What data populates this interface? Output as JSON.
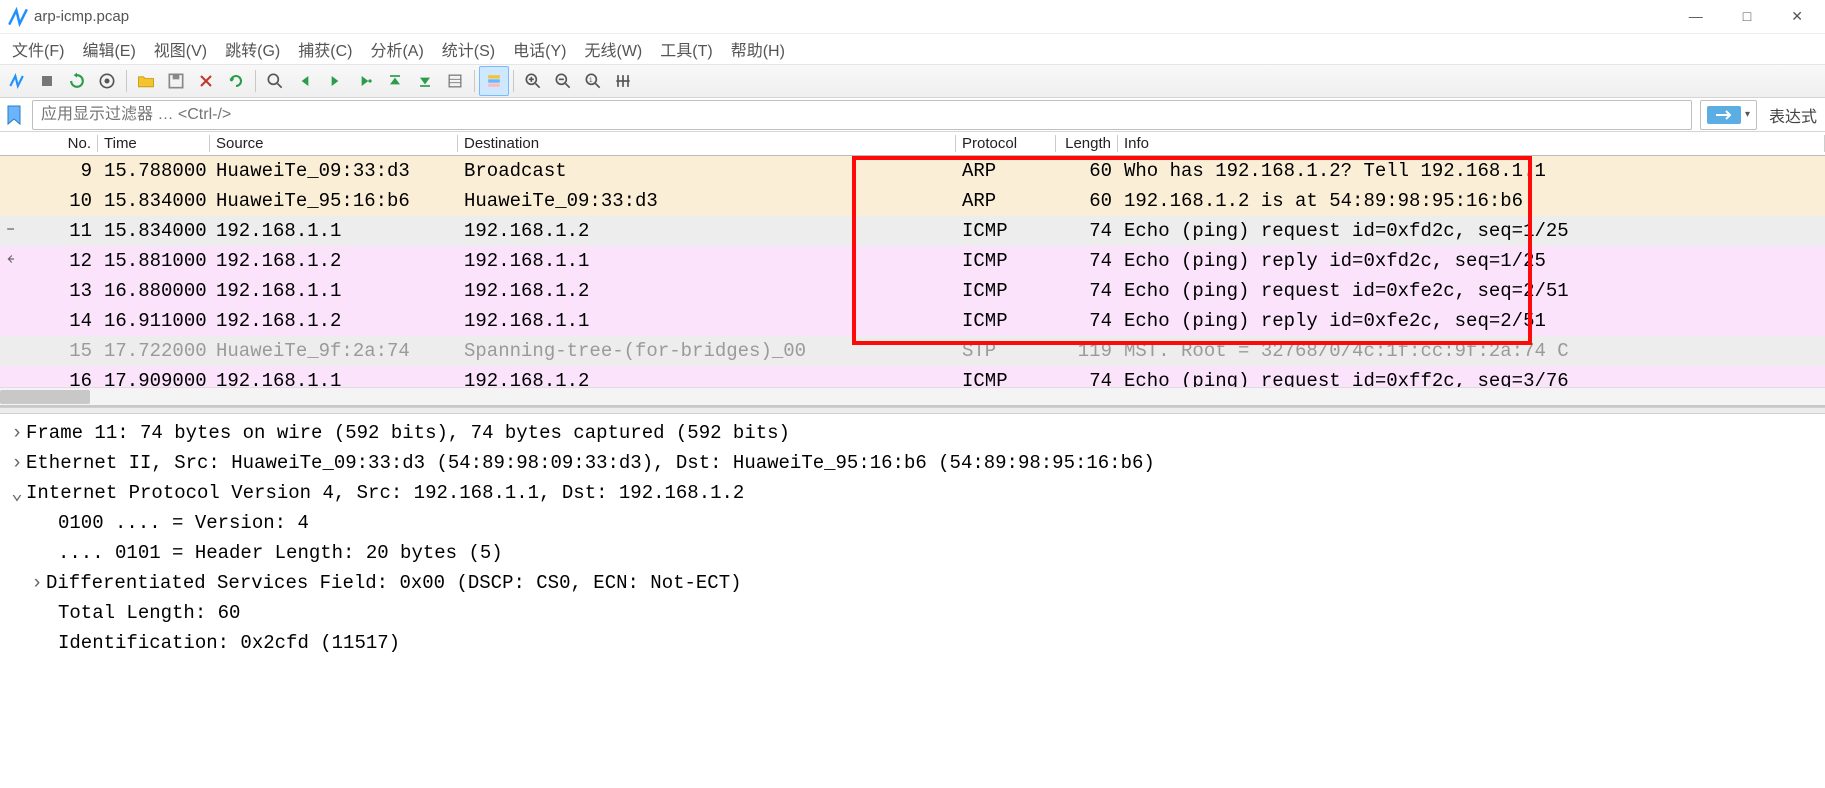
{
  "window": {
    "title": "arp-icmp.pcap",
    "buttons": {
      "min": "—",
      "max": "□",
      "close": "✕"
    }
  },
  "menu": {
    "file": "文件(F)",
    "edit": "编辑(E)",
    "view": "视图(V)",
    "go": "跳转(G)",
    "capture": "捕获(C)",
    "analyze": "分析(A)",
    "stats": "统计(S)",
    "teleph": "电话(Y)",
    "wireless": "无线(W)",
    "tools": "工具(T)",
    "help": "帮助(H)"
  },
  "filter": {
    "placeholder": "应用显示过滤器 … <Ctrl-/>",
    "expression": "表达式"
  },
  "columns": {
    "no": "No.",
    "time": "Time",
    "source": "Source",
    "destination": "Destination",
    "protocol": "Protocol",
    "length": "Length",
    "info": "Info"
  },
  "packets": [
    {
      "no": "9",
      "time": "15.788000",
      "src": "HuaweiTe_09:33:d3",
      "dst": "Broadcast",
      "proto": "ARP",
      "len": "60",
      "info": "Who has 192.168.1.2? Tell 192.168.1.1",
      "cls": "bg-arp",
      "arrow": ""
    },
    {
      "no": "10",
      "time": "15.834000",
      "src": "HuaweiTe_95:16:b6",
      "dst": "HuaweiTe_09:33:d3",
      "proto": "ARP",
      "len": "60",
      "info": "192.168.1.2 is at 54:89:98:95:16:b6",
      "cls": "bg-arp",
      "arrow": ""
    },
    {
      "no": "11",
      "time": "15.834000",
      "src": "192.168.1.1",
      "dst": "192.168.1.2",
      "proto": "ICMP",
      "len": "74",
      "info": "Echo (ping) request  id=0xfd2c, seq=1/25",
      "cls": "bg-sel",
      "arrow": "right"
    },
    {
      "no": "12",
      "time": "15.881000",
      "src": "192.168.1.2",
      "dst": "192.168.1.1",
      "proto": "ICMP",
      "len": "74",
      "info": "Echo (ping) reply    id=0xfd2c, seq=1/25",
      "cls": "bg-icmp",
      "arrow": "left"
    },
    {
      "no": "13",
      "time": "16.880000",
      "src": "192.168.1.1",
      "dst": "192.168.1.2",
      "proto": "ICMP",
      "len": "74",
      "info": "Echo (ping) request  id=0xfe2c, seq=2/51",
      "cls": "bg-icmp",
      "arrow": ""
    },
    {
      "no": "14",
      "time": "16.911000",
      "src": "192.168.1.2",
      "dst": "192.168.1.1",
      "proto": "ICMP",
      "len": "74",
      "info": "Echo (ping) reply    id=0xfe2c, seq=2/51",
      "cls": "bg-icmp",
      "arrow": ""
    },
    {
      "no": "15",
      "time": "17.722000",
      "src": "HuaweiTe_9f:2a:74",
      "dst": "Spanning-tree-(for-bridges)_00",
      "proto": "STP",
      "len": "119",
      "info": "MST. Root = 32768/0/4c:1f:cc:9f:2a:74  C",
      "cls": "bg-ign",
      "arrow": ""
    },
    {
      "no": "16",
      "time": "17.909000",
      "src": "192.168.1.1",
      "dst": "192.168.1.2",
      "proto": "ICMP",
      "len": "74",
      "info": "Echo (ping) request  id=0xff2c, seq=3/76",
      "cls": "bg-icmp",
      "arrow": ""
    }
  ],
  "details": {
    "l1": "Frame 11: 74 bytes on wire (592 bits), 74 bytes captured (592 bits)",
    "l2": "Ethernet II, Src: HuaweiTe_09:33:d3 (54:89:98:09:33:d3), Dst: HuaweiTe_95:16:b6 (54:89:98:95:16:b6)",
    "l3": "Internet Protocol Version 4, Src: 192.168.1.1, Dst: 192.168.1.2",
    "l4": "0100 .... = Version: 4",
    "l5": ".... 0101 = Header Length: 20 bytes (5)",
    "l6": "Differentiated Services Field: 0x00 (DSCP: CS0, ECN: Not-ECT)",
    "l7": "Total Length: 60",
    "l8": "Identification: 0x2cfd (11517)"
  },
  "glyph": {
    "tri_right": "›",
    "tri_down": "⌄"
  }
}
